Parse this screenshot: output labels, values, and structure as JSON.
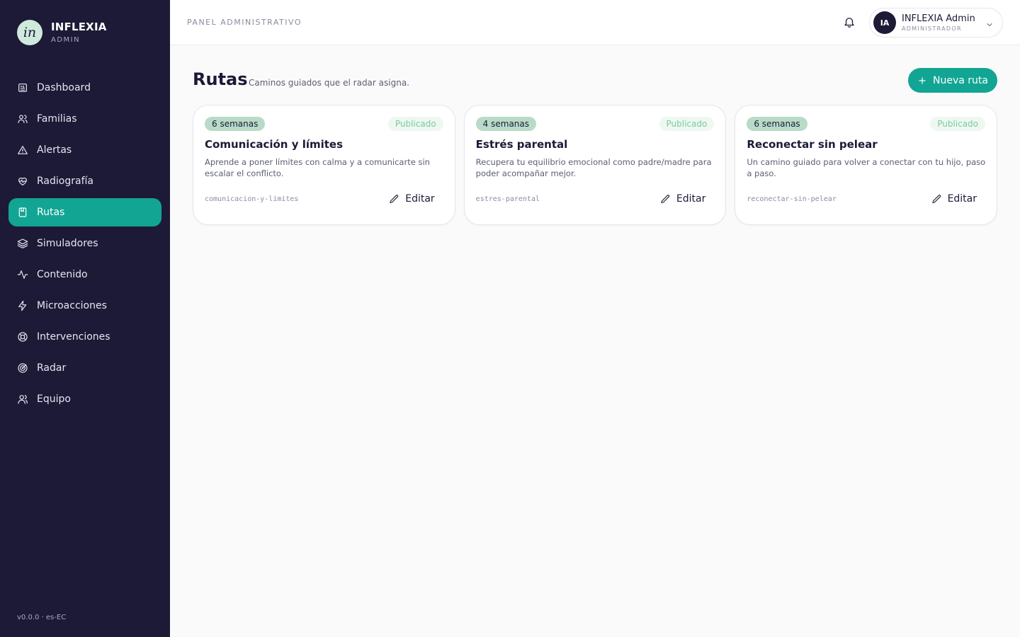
{
  "brand": {
    "logo_text": "in",
    "name": "INFLEXIA",
    "sub": "ADMIN"
  },
  "nav": {
    "items": [
      {
        "label": "Dashboard",
        "icon": "dashboard-icon",
        "active": false
      },
      {
        "label": "Familias",
        "icon": "users-icon",
        "active": false
      },
      {
        "label": "Alertas",
        "icon": "alert-triangle-icon",
        "active": false
      },
      {
        "label": "Radiografía",
        "icon": "heart-pulse-icon",
        "active": false
      },
      {
        "label": "Rutas",
        "icon": "book-icon",
        "active": true
      },
      {
        "label": "Simuladores",
        "icon": "layers-icon",
        "active": false
      },
      {
        "label": "Contenido",
        "icon": "activity-icon",
        "active": false
      },
      {
        "label": "Microacciones",
        "icon": "zap-icon",
        "active": false
      },
      {
        "label": "Intervenciones",
        "icon": "lifebuoy-icon",
        "active": false
      },
      {
        "label": "Radar",
        "icon": "radar-icon",
        "active": false
      },
      {
        "label": "Equipo",
        "icon": "user-team-icon",
        "active": false
      }
    ]
  },
  "version": "v0.0.0 · es-EC",
  "header": {
    "label": "PANEL ADMINISTRATIVO",
    "user": {
      "initials": "IA",
      "name": "INFLEXIA Admin",
      "role": "ADMINISTRADOR"
    }
  },
  "main": {
    "title": "Rutas",
    "subtitle": "Caminos guiados que el radar asigna.",
    "new_button": "Nueva ruta",
    "edit_label": "Editar",
    "cards": [
      {
        "weeks": "6 semanas",
        "status": "Publicado",
        "title": "Comunicación y límites",
        "description": "Aprende a poner límites con calma y a comunicarte sin escalar el conflicto.",
        "slug": "comunicacion-y-limites"
      },
      {
        "weeks": "4 semanas",
        "status": "Publicado",
        "title": "Estrés parental",
        "description": "Recupera tu equilibrio emocional como padre/madre para poder acompañar mejor.",
        "slug": "estres-parental"
      },
      {
        "weeks": "6 semanas",
        "status": "Publicado",
        "title": "Reconectar sin pelear",
        "description": "Un camino guiado para volver a conectar con tu hijo, paso a paso.",
        "slug": "reconectar-sin-pelear"
      }
    ]
  },
  "colors": {
    "sidebar_bg": "#1c1a36",
    "accent": "#12a594",
    "weeks_badge": "#b8dbc8",
    "status_text": "#7ccaa0"
  }
}
